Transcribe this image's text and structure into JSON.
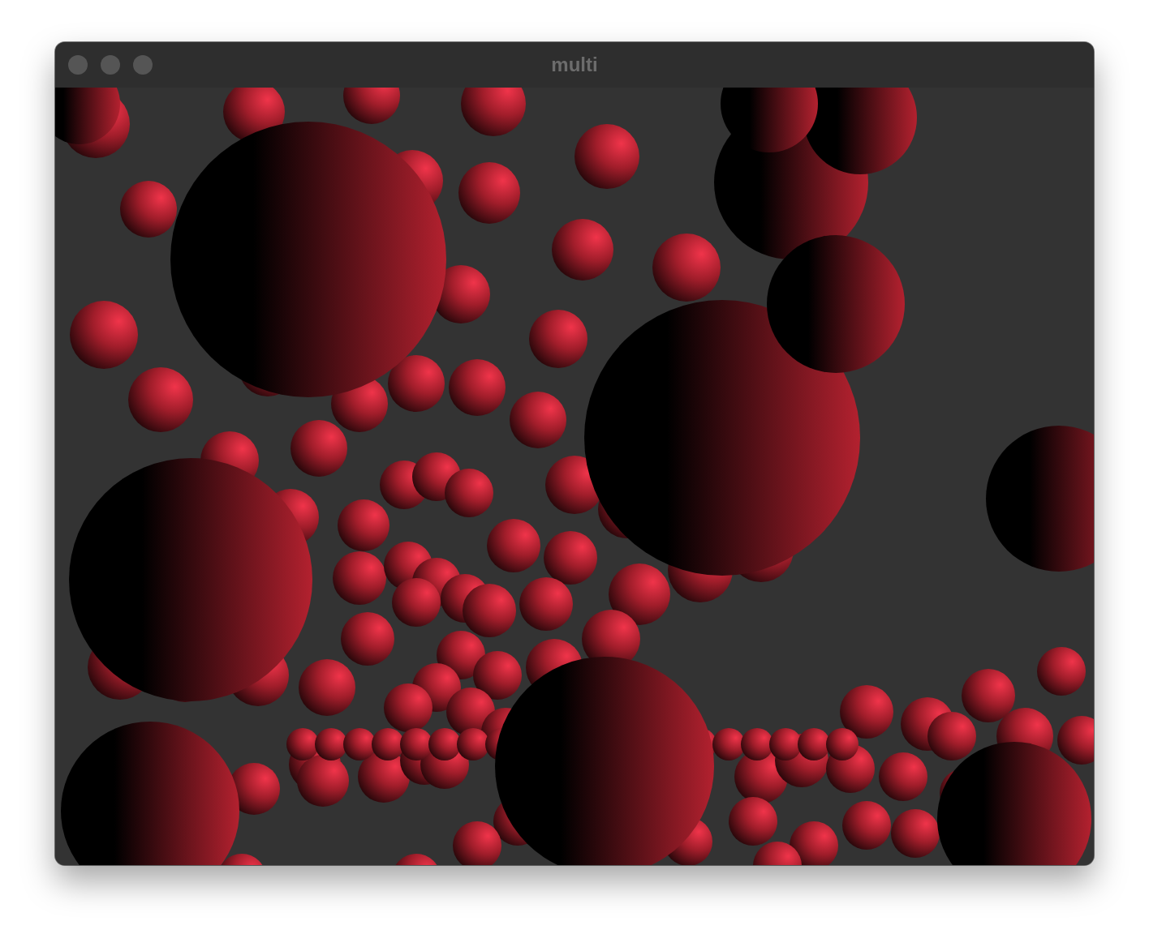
{
  "window": {
    "title": "multi"
  }
}
